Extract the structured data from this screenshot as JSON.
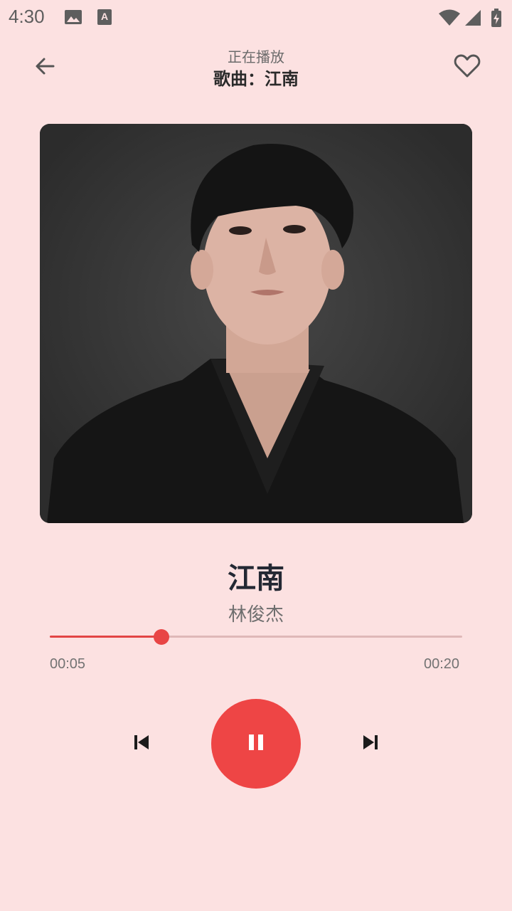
{
  "status_bar": {
    "time": "4:30",
    "icons": [
      "image-icon",
      "keyboard-a-icon",
      "wifi-icon",
      "signal-icon",
      "battery-charging-icon"
    ]
  },
  "header": {
    "subtitle": "正在播放",
    "title": "歌曲：江南",
    "back_icon": "arrow-left-icon",
    "favorite_icon": "heart-outline-icon"
  },
  "track": {
    "name": "江南",
    "artist": "林俊杰"
  },
  "progress": {
    "current": "00:05",
    "total": "00:20",
    "fraction": 0.27
  },
  "controls": {
    "prev_icon": "skip-previous-icon",
    "play_state_icon": "pause-icon",
    "next_icon": "skip-next-icon"
  },
  "colors": {
    "background": "#fce1e1",
    "accent": "#ee4545",
    "progress_track": "#dfb8b8"
  }
}
